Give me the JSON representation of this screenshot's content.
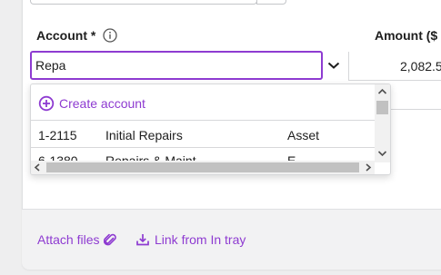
{
  "form": {
    "account_label": "Account *",
    "amount_label": "Amount ($",
    "account_input_value": "Repa",
    "amount_value": "2,082.5"
  },
  "dropdown": {
    "create_label": "Create account",
    "options": [
      {
        "code": "1-2115",
        "name": "Initial Repairs",
        "type": "Asset"
      },
      {
        "code": "6-1380",
        "name": "Repairs & Maint",
        "type": "E"
      }
    ]
  },
  "footer": {
    "attach_label": "Attach files",
    "link_tray_label": "Link from In tray"
  },
  "colors": {
    "accent": "#8e3bd1",
    "border": "#d7d8da"
  },
  "icons": [
    "info-icon",
    "chevron-down-icon",
    "plus-circle-icon",
    "paperclip-icon",
    "tray-download-icon",
    "scroll-arrow-icon"
  ]
}
